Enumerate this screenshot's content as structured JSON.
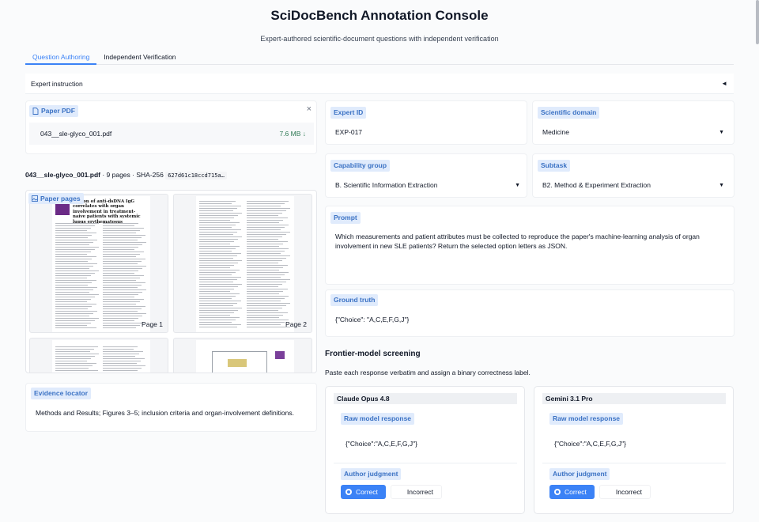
{
  "app": {
    "title": "SciDocBench Annotation Console",
    "subtitle": "Expert-authored scientific-document questions with independent verification"
  },
  "tabs": [
    {
      "label": "Question Authoring",
      "active": true
    },
    {
      "label": "Independent Verification",
      "active": false
    }
  ],
  "instruction": {
    "label": "Expert instruction",
    "caret": "◄"
  },
  "pdf": {
    "label": "Paper PDF",
    "close_icon": "×",
    "file_name": "043__sle-glyco_001.pdf",
    "file_size": "7.6 MB ↓",
    "meta_name": "043__sle-glyco_001.pdf",
    "meta_info": " · 9 pages · SHA-256 ",
    "sha": "627d61c18ccd715a…"
  },
  "pages": {
    "label": "Paper pages",
    "items": [
      {
        "label": "Page 1",
        "title_text": "ylation of anti-dsDNA IgG correlates with organ involvement in treatment-naive patients with systemic lupus erythematosus"
      },
      {
        "label": "Page 2"
      },
      {
        "label": ""
      },
      {
        "label": ""
      }
    ]
  },
  "evidence": {
    "label": "Evidence locator",
    "value": "Methods and Results; Figures 3–5; inclusion criteria and organ-involvement definitions."
  },
  "fields": {
    "expert_id": {
      "label": "Expert ID",
      "value": "EXP-017"
    },
    "domain": {
      "label": "Scientific domain",
      "value": "Medicine"
    },
    "capability": {
      "label": "Capability group",
      "value": "B. Scientific Information Extraction"
    },
    "subtask": {
      "label": "Subtask",
      "value": "B2. Method & Experiment Extraction"
    },
    "prompt": {
      "label": "Prompt",
      "value": "Which measurements and patient attributes must be collected to reproduce the paper's machine-learning analysis of organ involvement in new SLE patients? Return the selected option letters as JSON."
    },
    "ground_truth": {
      "label": "Ground truth",
      "value": "{\"Choice\": \"A,C,E,F,G,J\"}"
    }
  },
  "screening": {
    "heading": "Frontier-model screening",
    "note": "Paste each response verbatim and assign a binary correctness label.",
    "models": [
      {
        "name": "Claude Opus 4.8",
        "response_label": "Raw model response",
        "response": "{\"Choice\":\"A,C,E,F,G,J\"}",
        "judgment_label": "Author judgment",
        "correct_label": "Correct",
        "incorrect_label": "Incorrect",
        "selected": "correct"
      },
      {
        "name": "Gemini 3.1 Pro",
        "response_label": "Raw model response",
        "response": "{\"Choice\":\"A,C,E,F,G,J\"}",
        "judgment_label": "Author judgment",
        "correct_label": "Correct",
        "incorrect_label": "Incorrect",
        "selected": "correct"
      }
    ]
  },
  "colors": {
    "accent": "#3b82f6",
    "chip_bg": "#e0ebfc",
    "chip_text": "#3b72c4",
    "download": "#2f7a55"
  }
}
